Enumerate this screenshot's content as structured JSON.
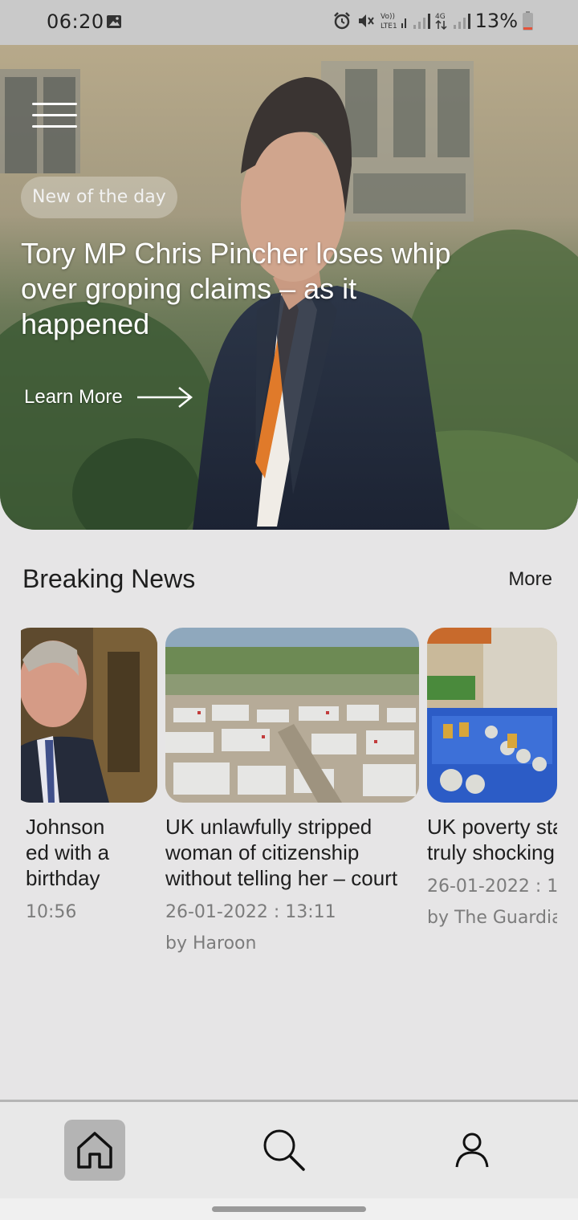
{
  "status_bar": {
    "time": "06:20",
    "battery": "13%",
    "icons": [
      "gallery-icon",
      "alarm-icon",
      "mute-icon",
      "volte-icon",
      "signal-icon",
      "4g-icon",
      "signal-icon",
      "battery-icon"
    ],
    "network_lte": "LTE1",
    "network_4g": "4G"
  },
  "hero": {
    "badge": "New of the day",
    "title": "Tory MP Chris Pincher loses whip over groping claims – as it happened",
    "learn_more": "Learn More"
  },
  "breaking": {
    "title": "Breaking News",
    "more": "More",
    "cards": [
      {
        "title": " Johnson\ned with a\nbirthday",
        "date": "10:56",
        "author": ""
      },
      {
        "title": "UK unlawfully stripped woman of citizenship without telling her – court",
        "date": "26-01-2022 : 13:11",
        "author": "by Haroon"
      },
      {
        "title": "UK poverty sta\ntruly shocking",
        "date": "26-01-2022 : 1",
        "author": "by The Guardia"
      }
    ]
  },
  "nav": {
    "items": [
      "home-icon",
      "search-icon",
      "profile-icon"
    ],
    "active": "home"
  },
  "colors": {
    "background": "#e6e5e6",
    "status_bar": "#c9c9c9",
    "nav_active": "#b4b4b4",
    "battery_low": "#e5533a"
  }
}
